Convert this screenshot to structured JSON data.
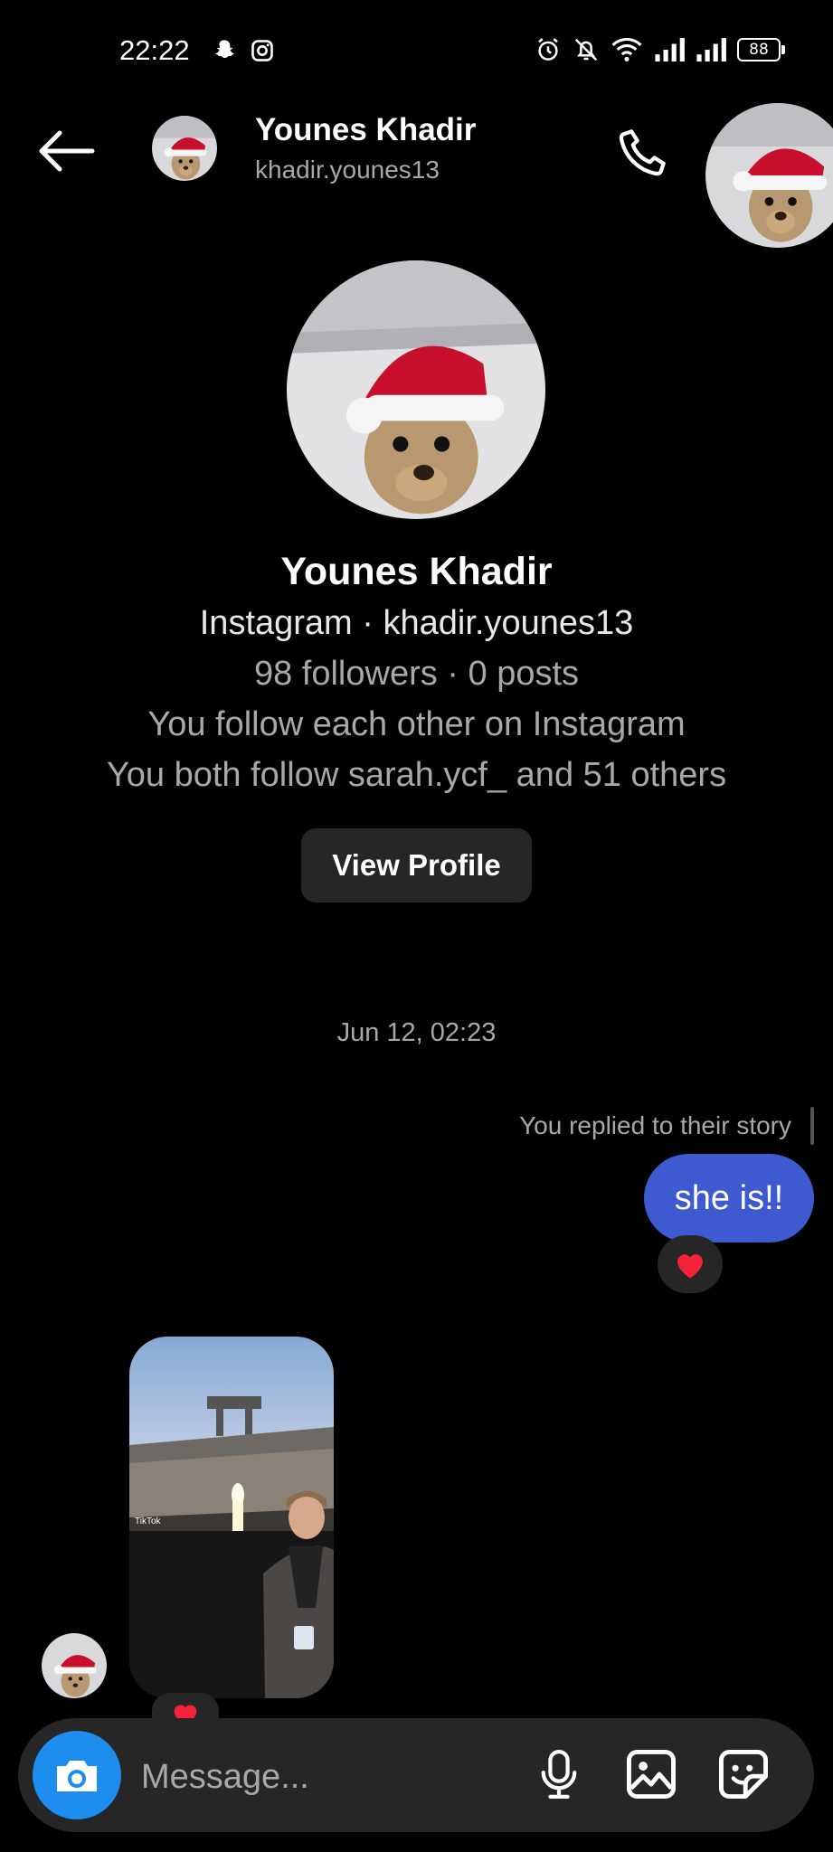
{
  "status_bar": {
    "time": "22:22",
    "battery": "88",
    "icons_left": [
      "snapchat-icon",
      "instagram-icon"
    ],
    "icons_right": [
      "alarm-icon",
      "muted-bell-icon",
      "wifi-icon",
      "signal-icon",
      "signal-icon",
      "battery-icon"
    ]
  },
  "header": {
    "name": "Younes Khadir",
    "username": "khadir.younes13"
  },
  "profile": {
    "name": "Younes Khadir",
    "line1": "Instagram · khadir.younes13",
    "line2": "98 followers · 0 posts",
    "line3": "You follow each other on Instagram",
    "line4": "You both follow sarah.ycf_ and 51 others",
    "view_profile_label": "View Profile"
  },
  "conversation": {
    "timestamp": "Jun 12, 02:23",
    "story_reply_note": "You replied to their story",
    "sent_message": "she is!!",
    "reaction": "❤️",
    "media_watermark": "TikTok"
  },
  "composer": {
    "placeholder": "Message..."
  },
  "colors": {
    "background": "#000000",
    "sent_bubble": "#3d5ad1",
    "camera_button": "#1d8df0",
    "surface": "#262626",
    "muted_text": "#a8a8a8"
  }
}
